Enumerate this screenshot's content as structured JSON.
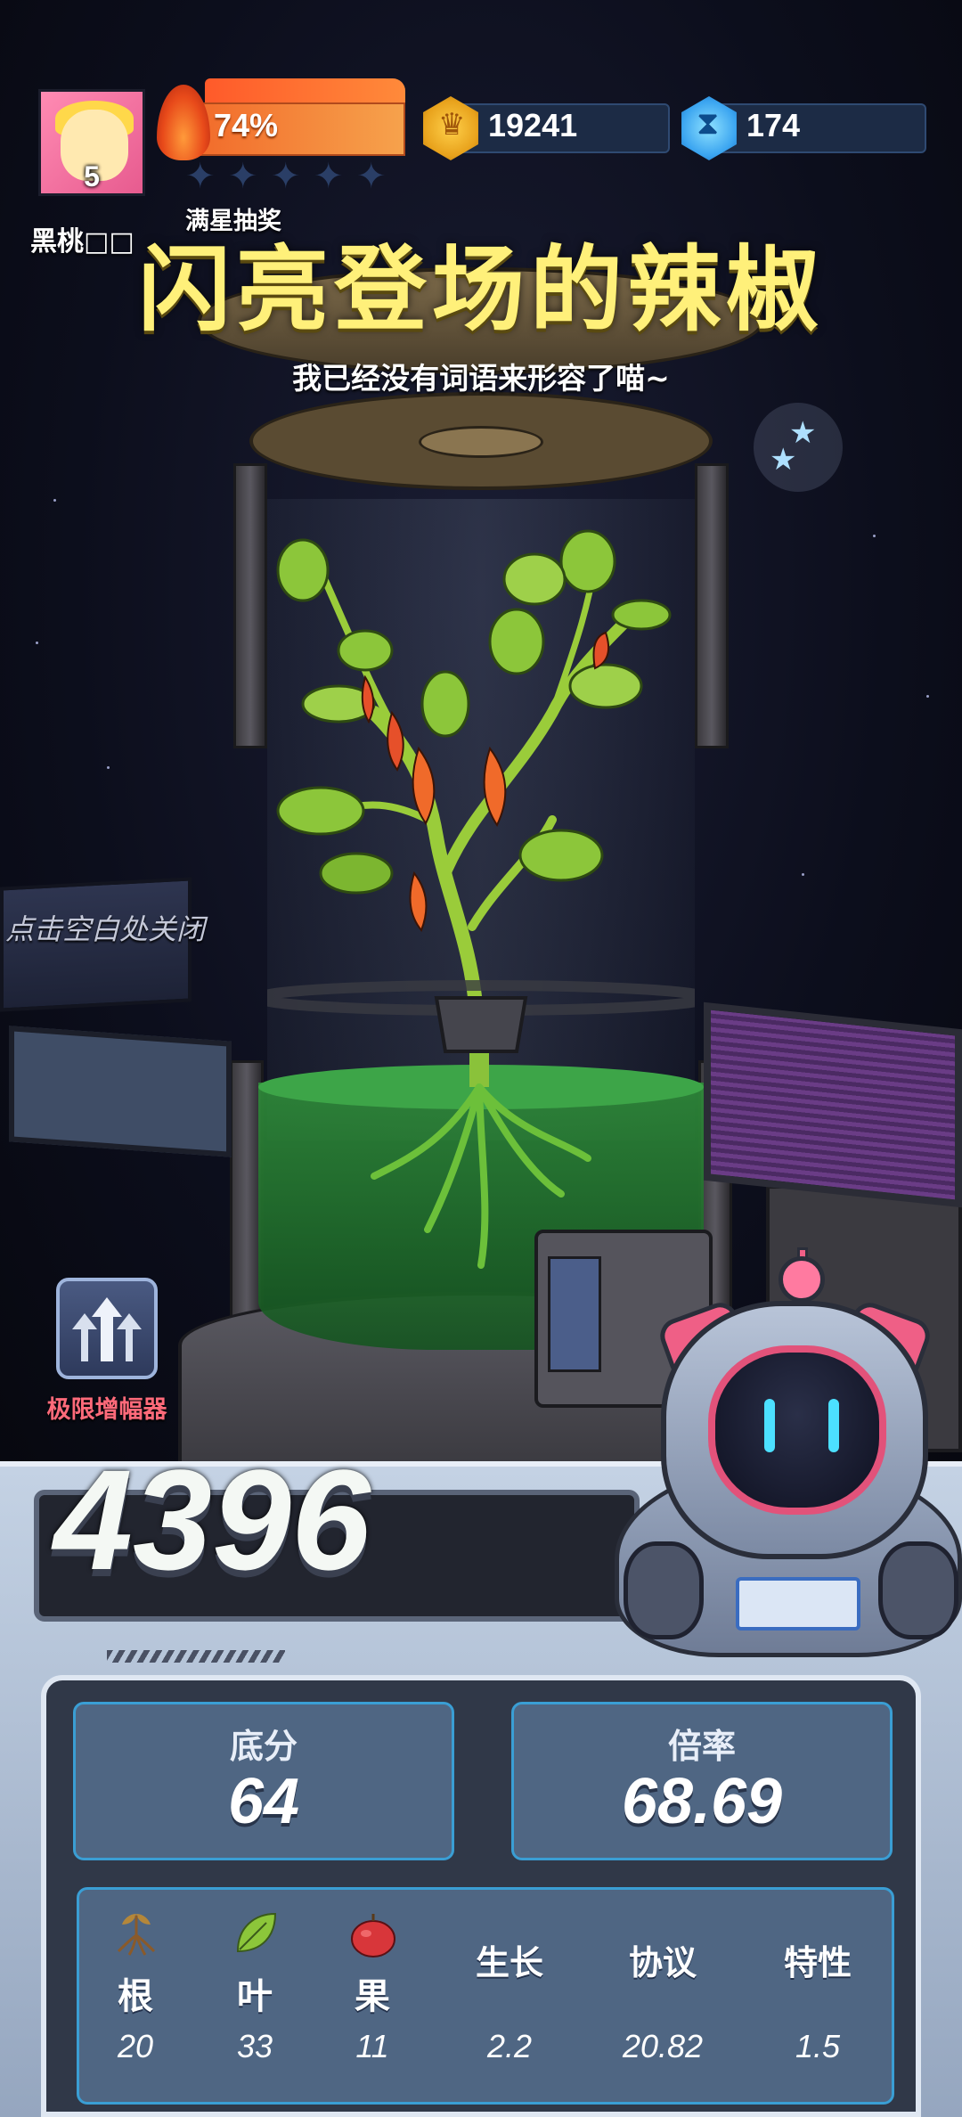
{
  "player": {
    "level": "5",
    "name": "黑桃□□",
    "heat_percent": "74%",
    "star_bonus_label": "满星抽奖",
    "rank_stars_filled": 0,
    "rank_stars_total": 5
  },
  "currency": {
    "coins": "19241",
    "gems": "174"
  },
  "result": {
    "title": "闪亮登场的辣椒",
    "subtitle": "我已经没有词语来形容了喵~"
  },
  "hints": {
    "close": "点击空白处关闭"
  },
  "amplifier": {
    "label": "极限增幅器"
  },
  "score": {
    "total": "4396",
    "base_label": "底分",
    "base_value": "64",
    "multiplier_label": "倍率",
    "multiplier_value": "68.69"
  },
  "attributes": [
    {
      "name": "根",
      "value": "20",
      "icon": "root-icon"
    },
    {
      "name": "叶",
      "value": "33",
      "icon": "leaf-icon"
    },
    {
      "name": "果",
      "value": "11",
      "icon": "apple-icon"
    },
    {
      "name": "生长",
      "value": "2.2"
    },
    {
      "name": "协议",
      "value": "20.82"
    },
    {
      "name": "特性",
      "value": "1.5"
    }
  ],
  "colors": {
    "title": "#fff07a",
    "accent_red": "#ff6a7a",
    "card_border": "#3a9ed4",
    "card_bg": "#4f6683"
  }
}
